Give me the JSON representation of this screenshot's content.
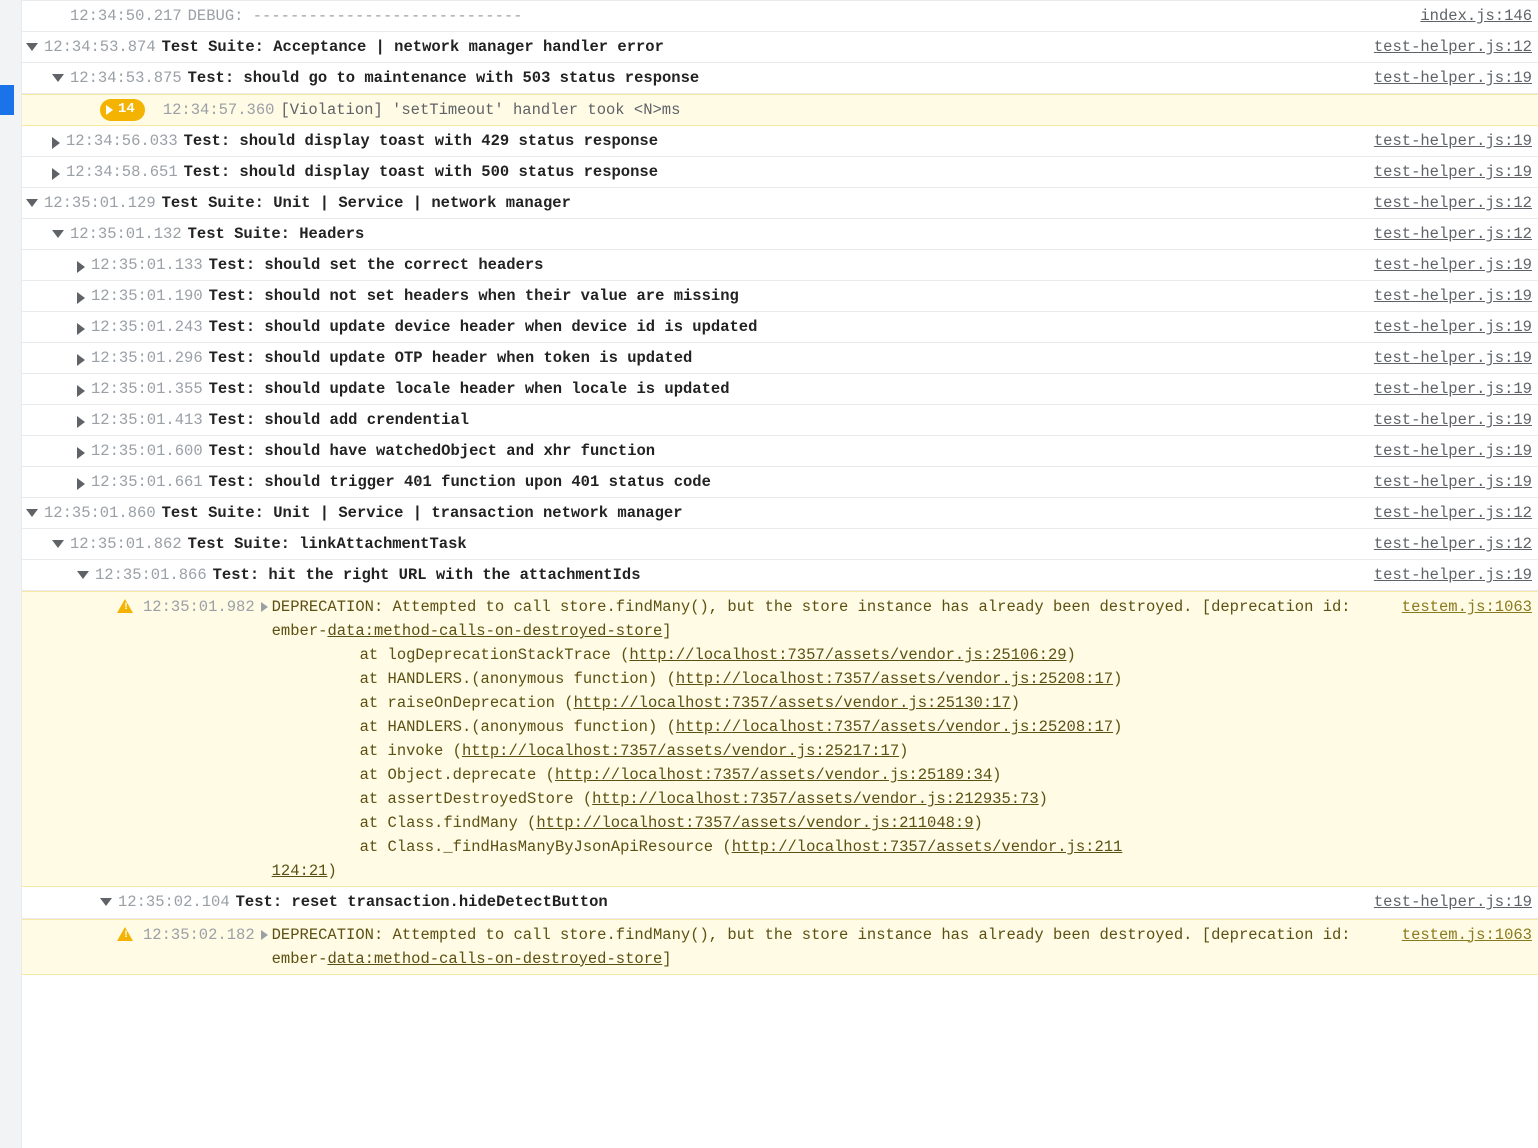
{
  "rows": [
    {
      "type": "log",
      "indent": 1,
      "arrow": "none",
      "ts": "12:34:50.217",
      "label": "DEBUG",
      "message": "-----------------------------",
      "src": "index.js:146",
      "dim": true
    },
    {
      "type": "group",
      "indent": 0,
      "arrow": "down",
      "ts": "12:34:53.874",
      "message": "Test Suite: Acceptance | network manager handler error",
      "src": "test-helper.js:12"
    },
    {
      "type": "group",
      "indent": 1,
      "arrow": "down",
      "ts": "12:34:53.875",
      "message": "Test: should go to maintenance with 503 status response",
      "src": "test-helper.js:19"
    },
    {
      "type": "violation",
      "indent": 2,
      "badge": "14",
      "ts": "12:34:57.360",
      "message": "[Violation] 'setTimeout' handler took <N>ms"
    },
    {
      "type": "group",
      "indent": 1,
      "arrow": "right",
      "ts": "12:34:56.033",
      "message": "Test: should display toast with 429 status response",
      "src": "test-helper.js:19"
    },
    {
      "type": "group",
      "indent": 1,
      "arrow": "right",
      "ts": "12:34:58.651",
      "message": "Test: should display toast with 500 status response",
      "src": "test-helper.js:19"
    },
    {
      "type": "group",
      "indent": 0,
      "arrow": "down",
      "ts": "12:35:01.129",
      "message": "Test Suite: Unit | Service | network manager",
      "src": "test-helper.js:12"
    },
    {
      "type": "group",
      "indent": 1,
      "arrow": "down",
      "ts": "12:35:01.132",
      "message": "Test Suite: Headers",
      "src": "test-helper.js:12"
    },
    {
      "type": "group",
      "indent": 2,
      "arrow": "right",
      "ts": "12:35:01.133",
      "message": "Test: should set the correct headers",
      "src": "test-helper.js:19"
    },
    {
      "type": "group",
      "indent": 2,
      "arrow": "right",
      "ts": "12:35:01.190",
      "message": "Test: should not set headers when their value are missing",
      "src": "test-helper.js:19"
    },
    {
      "type": "group",
      "indent": 2,
      "arrow": "right",
      "ts": "12:35:01.243",
      "message": "Test: should update device header when device id is updated",
      "src": "test-helper.js:19"
    },
    {
      "type": "group",
      "indent": 2,
      "arrow": "right",
      "ts": "12:35:01.296",
      "message": "Test: should update OTP header when token is updated",
      "src": "test-helper.js:19"
    },
    {
      "type": "group",
      "indent": 2,
      "arrow": "right",
      "ts": "12:35:01.355",
      "message": "Test: should update locale header when locale is updated",
      "src": "test-helper.js:19"
    },
    {
      "type": "group",
      "indent": 2,
      "arrow": "right",
      "ts": "12:35:01.413",
      "message": "Test: should add crendential",
      "src": "test-helper.js:19"
    },
    {
      "type": "group",
      "indent": 2,
      "arrow": "right",
      "ts": "12:35:01.600",
      "message": "Test: should have watchedObject and xhr function",
      "src": "test-helper.js:19"
    },
    {
      "type": "group",
      "indent": 2,
      "arrow": "right",
      "ts": "12:35:01.661",
      "message": "Test: should trigger 401 function upon 401 status code",
      "src": "test-helper.js:19"
    },
    {
      "type": "group",
      "indent": 0,
      "arrow": "down",
      "ts": "12:35:01.860",
      "message": "Test Suite: Unit | Service | transaction network manager",
      "src": "test-helper.js:12"
    },
    {
      "type": "group",
      "indent": 1,
      "arrow": "down",
      "ts": "12:35:01.862",
      "message": "Test Suite: linkAttachmentTask",
      "src": "test-helper.js:12"
    },
    {
      "type": "group",
      "indent": 2,
      "arrow": "down",
      "ts": "12:35:01.866",
      "message": "Test: hit the right URL with the attachmentIds",
      "src": "test-helper.js:19"
    }
  ],
  "deprecation1": {
    "ts": "12:35:01.982",
    "src": "testem.js:1063",
    "prefix": "DEPRECATION: Attempted to call store.findMany(), but the store instance has already been destroyed. [deprecation id: ember-",
    "dep_id_link": "data:method-calls-on-destroyed-store",
    "suffix": "]",
    "stack": [
      {
        "at": "at logDeprecationStackTrace (",
        "url": "http://localhost:7357/assets/vendor.js:25106:29",
        "close": ")"
      },
      {
        "at": "at HANDLERS.(anonymous function) (",
        "url": "http://localhost:7357/assets/vendor.js:25208:17",
        "close": ")"
      },
      {
        "at": "at raiseOnDeprecation (",
        "url": "http://localhost:7357/assets/vendor.js:25130:17",
        "close": ")"
      },
      {
        "at": "at HANDLERS.(anonymous function) (",
        "url": "http://localhost:7357/assets/vendor.js:25208:17",
        "close": ")"
      },
      {
        "at": "at invoke (",
        "url": "http://localhost:7357/assets/vendor.js:25217:17",
        "close": ")"
      },
      {
        "at": "at Object.deprecate (",
        "url": "http://localhost:7357/assets/vendor.js:25189:34",
        "close": ")"
      },
      {
        "at": "at assertDestroyedStore (",
        "url": "http://localhost:7357/assets/vendor.js:212935:73",
        "close": ")"
      },
      {
        "at": "at Class.findMany (",
        "url": "http://localhost:7357/assets/vendor.js:211048:9",
        "close": ")"
      },
      {
        "at": "at Class._findHasManyByJsonApiResource (",
        "url": "http://localhost:7357/assets/vendor.js:211124:21",
        "close": ")"
      }
    ]
  },
  "row_reset": {
    "ts": "12:35:02.104",
    "message": "Test: reset transaction.hideDetectButton",
    "src": "test-helper.js:19"
  },
  "deprecation2": {
    "ts": "12:35:02.182",
    "src": "testem.js:1063",
    "prefix": "DEPRECATION: Attempted to call store.findMany(), but the store instance has already been destroyed. [deprecation id: ember-",
    "dep_id_link": "data:method-calls-on-destroyed-store",
    "suffix": "]"
  }
}
